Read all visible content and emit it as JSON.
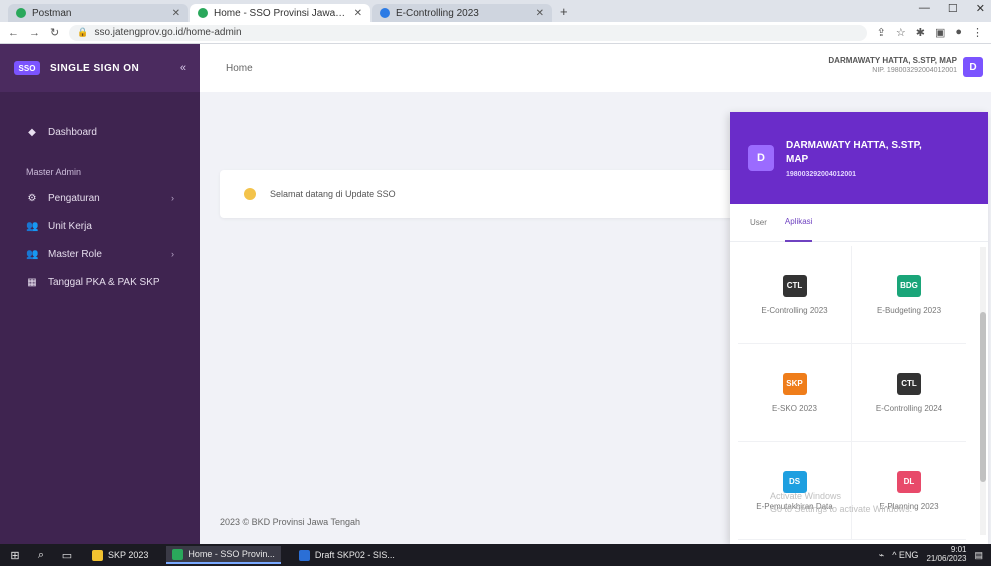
{
  "browser": {
    "tabs": [
      {
        "label": "Postman",
        "active": false
      },
      {
        "label": "Home - SSO Provinsi Jawa Tengah",
        "active": true
      },
      {
        "label": "E-Controlling 2023",
        "active": false
      }
    ],
    "new_tab": "+",
    "url": "sso.jatengprov.go.id/home-admin",
    "window_controls": [
      "—",
      "☐",
      "✕"
    ]
  },
  "sidebar": {
    "brand_logo": "SSO",
    "brand_name": "SINGLE SIGN ON",
    "toggle": "«",
    "dashboard": "Dashboard",
    "section": "Master Admin",
    "items": [
      {
        "label": "Pengaturan",
        "icon": "gear-icon"
      },
      {
        "label": "Unit Kerja",
        "icon": "users-icon"
      },
      {
        "label": "Master Role",
        "icon": "users-icon"
      },
      {
        "label": "Tanggal PKA & PAK SKP",
        "icon": "calendar-icon"
      }
    ]
  },
  "header": {
    "breadcrumb": "Home",
    "user_name": "DARMAWATY HATTA, S.STP, MAP",
    "user_nip": "NIP. 198003292004012001",
    "avatar": "D"
  },
  "welcome": {
    "text": "Selamat datang di Update SSO"
  },
  "footer": {
    "text": "2023 © BKD Provinsi Jawa Tengah"
  },
  "panel": {
    "avatar": "D",
    "name_line1": "DARMAWATY HATTA, S.STP,",
    "name_line2": "MAP",
    "nip": "198003292004012001",
    "tabs": [
      {
        "label": "User",
        "active": false
      },
      {
        "label": "Aplikasi",
        "active": true
      }
    ],
    "apps": [
      {
        "logo": "CTL",
        "label": "E-Controlling 2023",
        "color": "#333333"
      },
      {
        "logo": "BDG",
        "label": "E-Budgeting 2023",
        "color": "#1aa579"
      },
      {
        "logo": "SKP",
        "label": "E-SKO 2023",
        "color": "#ef7d1a"
      },
      {
        "logo": "CTL",
        "label": "E-Controlling 2024",
        "color": "#333333"
      },
      {
        "logo": "DS",
        "label": "E-Pemutakhiran Data",
        "color": "#1e9fe0"
      },
      {
        "logo": "DL",
        "label": "E-Planning 2023",
        "color": "#e84a6a"
      }
    ],
    "watermark_line1": "Activate Windows",
    "watermark_line2": "Go to Settings to activate Windows."
  },
  "taskbar": {
    "apps": [
      {
        "label": "SKP 2023",
        "color": "#f2c230",
        "active": false
      },
      {
        "label": "Home - SSO Provin...",
        "color": "#2aa85b",
        "active": true
      },
      {
        "label": "Draft SKP02 - SIS...",
        "color": "#2b6fd6",
        "active": false
      }
    ],
    "tray": "^ ENG",
    "time": "9:01",
    "date": "21/06/2023"
  }
}
